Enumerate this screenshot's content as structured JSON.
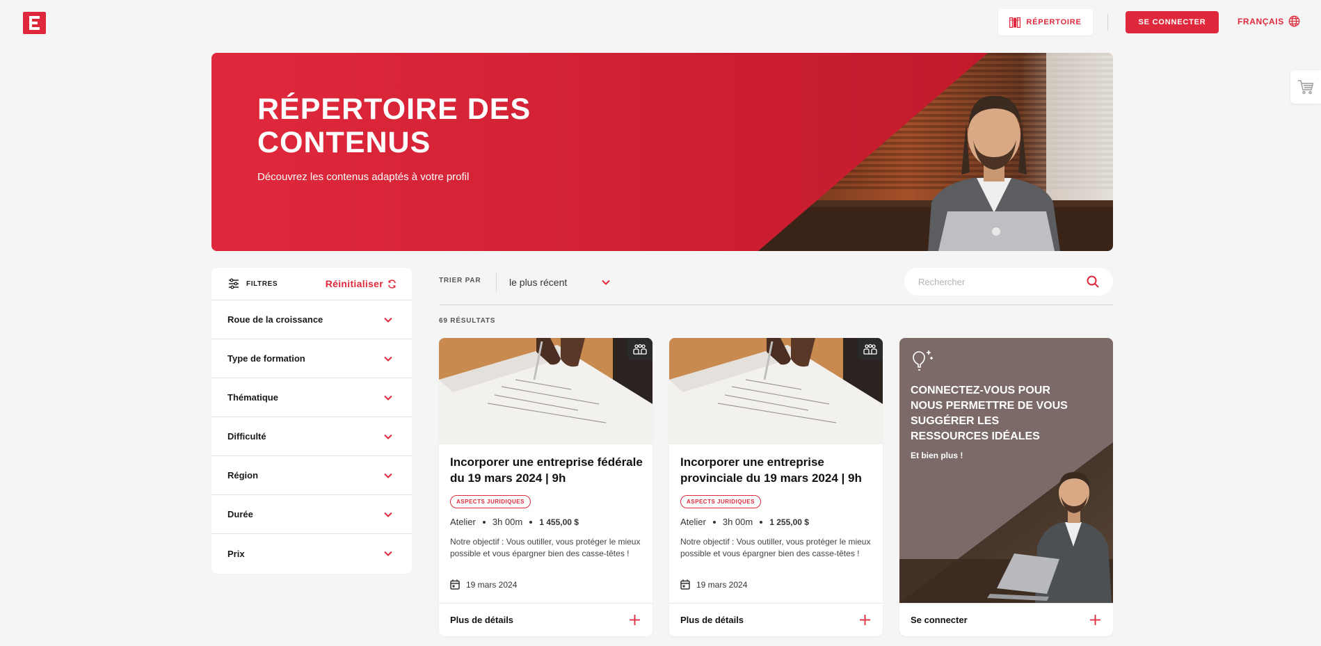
{
  "header": {
    "directory_label": "RÉPERTOIRE",
    "login_label": "SE CONNECTER",
    "language_label": "FRANÇAIS"
  },
  "hero": {
    "title": "RÉPERTOIRE DES CONTENUS",
    "subtitle": "Découvrez les contenus adaptés à votre profil"
  },
  "filters": {
    "title": "FILTRES",
    "reset_label": "Réinitialiser",
    "items": [
      {
        "label": "Roue de la croissance"
      },
      {
        "label": "Type de formation"
      },
      {
        "label": "Thématique"
      },
      {
        "label": "Difficulté"
      },
      {
        "label": "Région"
      },
      {
        "label": "Durée"
      },
      {
        "label": "Prix"
      }
    ]
  },
  "sort": {
    "label": "TRIER PAR",
    "value": "le plus récent"
  },
  "search": {
    "placeholder": "Rechercher"
  },
  "results": {
    "count_label": "69 RÉSULTATS"
  },
  "cards": [
    {
      "title": "Incorporer une entreprise fédérale du 19 mars 2024 | 9h",
      "tag": "ASPECTS JURIDIQUES",
      "type": "Atelier",
      "duration": "3h 00m",
      "price": "1 455,00 $",
      "description": "Notre objectif : Vous outiller, vous protéger le mieux possible et vous épargner bien des casse-têtes !",
      "date": "19 mars 2024",
      "footer_label": "Plus de détails"
    },
    {
      "title": "Incorporer une entreprise provinciale du 19 mars 2024 | 9h",
      "tag": "ASPECTS JURIDIQUES",
      "type": "Atelier",
      "duration": "3h 00m",
      "price": "1 255,00 $",
      "description": "Notre objectif : Vous outiller, vous protéger le mieux possible et vous épargner bien des casse-têtes !",
      "date": "19 mars 2024",
      "footer_label": "Plus de détails"
    }
  ],
  "promo": {
    "title": "CONNECTEZ-VOUS POUR NOUS PERMETTRE DE VOUS SUGGÉRER LES RESSOURCES IDÉALES",
    "subtitle": "Et bien plus !",
    "footer_label": "Se connecter"
  },
  "colors": {
    "accent": "#e0283c",
    "background": "#f5f5f5",
    "promo_bg": "#7b6a68"
  }
}
